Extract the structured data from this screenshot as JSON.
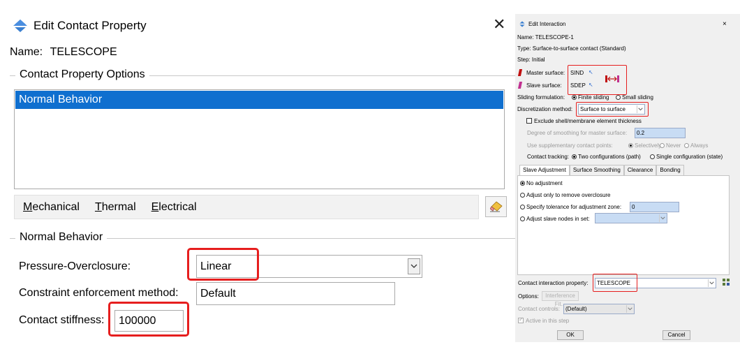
{
  "left_dialog": {
    "title": "Edit Contact Property",
    "close_glyph": "✕",
    "name_label": "Name:",
    "name_value": "TELESCOPE",
    "options_group_label": "Contact Property Options",
    "options_list": [
      {
        "label": "Normal Behavior",
        "selected": true
      }
    ],
    "menus": [
      {
        "key": "M",
        "rest": "echanical"
      },
      {
        "key": "T",
        "rest": "hermal"
      },
      {
        "key": "E",
        "rest": "lectrical"
      }
    ],
    "behavior_group_label": "Normal Behavior",
    "pressure_label": "Pressure-Overclosure:",
    "pressure_value": "Linear",
    "constraint_label": "Constraint enforcement method:",
    "constraint_value": "Default",
    "stiffness_label": "Contact stiffness:",
    "stiffness_value": "100000",
    "highlight_color": "#e61e1e",
    "selection_color": "#0f6fcf"
  },
  "right_dialog": {
    "title": "Edit Interaction",
    "close_glyph": "×",
    "name_line": "Name:  TELESCOPE-1",
    "type_line": "Type:   Surface-to-surface contact (Standard)",
    "step_line": "Step:   Initial",
    "master_label": "Master surface:",
    "master_value": "SIND",
    "slave_label": "Slave surface:",
    "slave_value": "SDEP",
    "sliding_label": "Sliding formulation:",
    "sliding_opt1": "Finite sliding",
    "sliding_opt2": "Small sliding",
    "discretization_label": "Discretization method:",
    "discretization_value": "Surface to surface",
    "exclude_label": "Exclude shell/membrane element thickness",
    "smoothing_label": "Degree of smoothing for master surface:",
    "smoothing_value": "0.2",
    "supp_label": "Use supplementary contact points:",
    "supp_opt1": "Selectively",
    "supp_opt2": "Never",
    "supp_opt3": "Always",
    "tracking_label": "Contact tracking:",
    "tracking_opt1": "Two configurations (path)",
    "tracking_opt2": "Single configuration (state)",
    "tabs": [
      "Slave Adjustment",
      "Surface Smoothing",
      "Clearance",
      "Bonding"
    ],
    "adj_opt1": "No adjustment",
    "adj_opt2": "Adjust only to remove overclosure",
    "adj_opt3": "Specify tolerance for adjustment zone:",
    "adj_tol_value": "0",
    "adj_opt4": "Adjust slave nodes in set:",
    "prop_label": "Contact interaction property:",
    "prop_value": "TELESCOPE",
    "options_label": "Options:",
    "options_btn": "Interference Fit...",
    "controls_label": "Contact controls:",
    "controls_value": "(Default)",
    "active_label": "Active in this step",
    "ok_label": "OK",
    "cancel_label": "Cancel"
  }
}
